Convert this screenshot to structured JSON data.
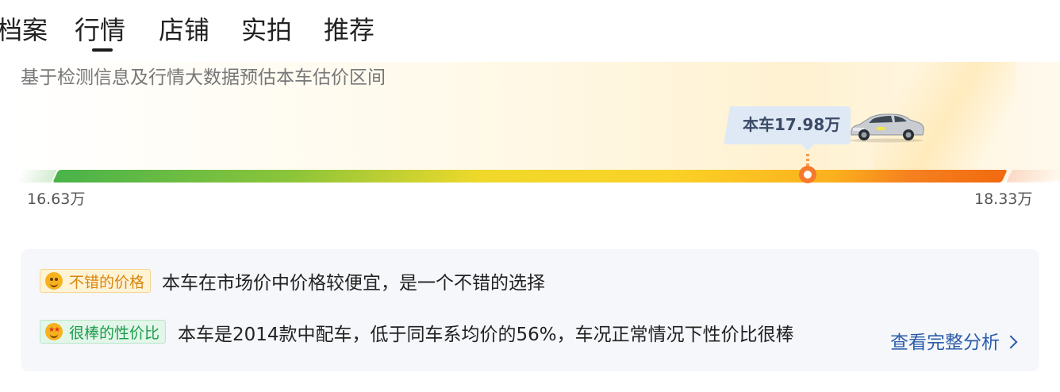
{
  "tabs": {
    "items": [
      {
        "label": "档案",
        "active": false
      },
      {
        "label": "行情",
        "active": true
      },
      {
        "label": "店铺",
        "active": false
      },
      {
        "label": "实拍",
        "active": false
      },
      {
        "label": "推荐",
        "active": false
      }
    ]
  },
  "price": {
    "subtitle": "基于检测信息及行情大数据预估本车估价区间",
    "current_label": "本车17.98万",
    "range_low": "16.63万",
    "range_high": "18.33万",
    "position_fraction": 0.794,
    "gradient_colors": [
      "#49b34a",
      "#8cc53a",
      "#f0d92a",
      "#fbb01d",
      "#f26a10"
    ],
    "car_icon": "sedan-car-icon"
  },
  "analysis": {
    "items": [
      {
        "badge": "不错的价格",
        "icon": "smile-emoji-icon",
        "text": "本车在市场价中价格较便宜，是一个不错的选择",
        "color": "#d9860b"
      },
      {
        "badge": "很棒的性价比",
        "icon": "star-eyes-emoji-icon",
        "text": "本车是2014款中配车，低于同车系均价的56%，车况正常情况下性价比很棒",
        "color": "#1a9c4a"
      }
    ],
    "link_label": "查看完整分析"
  }
}
